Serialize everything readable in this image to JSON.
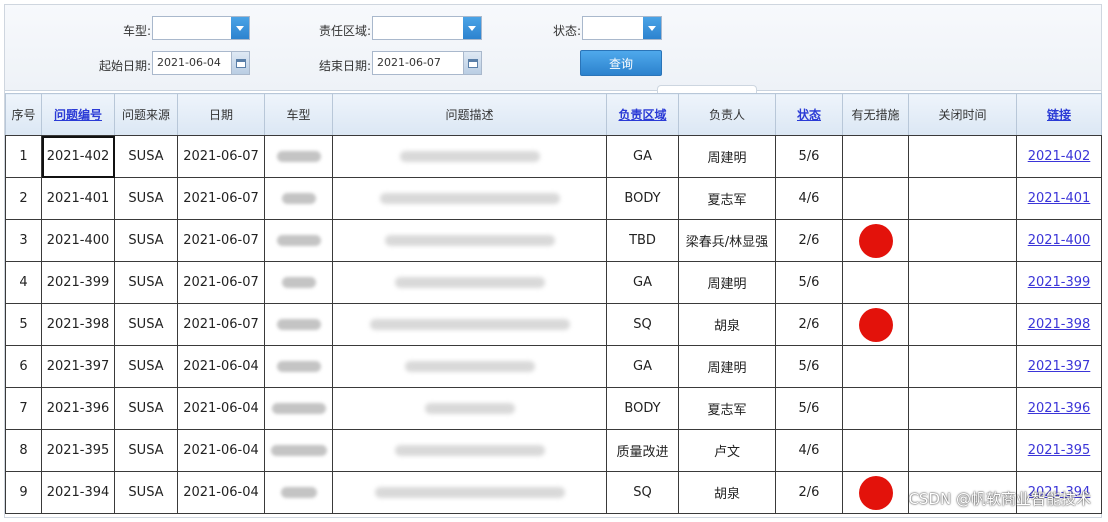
{
  "filters": {
    "car_type_label": "车型:",
    "zone_label": "责任区域:",
    "status_label": "状态:",
    "start_date_label": "起始日期:",
    "start_date_value": "2021-06-04",
    "end_date_label": "结束日期:",
    "end_date_value": "2021-06-07",
    "query_button": "查询"
  },
  "table": {
    "headers": [
      "序号",
      "问题编号",
      "问题来源",
      "日期",
      "车型",
      "问题描述",
      "负责区域",
      "负责人",
      "状态",
      "有无措施",
      "关闭时间",
      "链接"
    ],
    "rows": [
      {
        "no": "1",
        "id": "2021-402",
        "source": "SUSA",
        "date": "2021-06-07",
        "zone": "GA",
        "owner": "周建明",
        "status": "5/6",
        "measure": false,
        "link": "2021-402"
      },
      {
        "no": "2",
        "id": "2021-401",
        "source": "SUSA",
        "date": "2021-06-07",
        "zone": "BODY",
        "owner": "夏志军",
        "status": "4/6",
        "measure": false,
        "link": "2021-401"
      },
      {
        "no": "3",
        "id": "2021-400",
        "source": "SUSA",
        "date": "2021-06-07",
        "zone": "TBD",
        "owner": "梁春兵/林显强",
        "status": "2/6",
        "measure": true,
        "link": "2021-400"
      },
      {
        "no": "4",
        "id": "2021-399",
        "source": "SUSA",
        "date": "2021-06-07",
        "zone": "GA",
        "owner": "周建明",
        "status": "5/6",
        "measure": false,
        "link": "2021-399"
      },
      {
        "no": "5",
        "id": "2021-398",
        "source": "SUSA",
        "date": "2021-06-07",
        "zone": "SQ",
        "owner": "胡泉",
        "status": "2/6",
        "measure": true,
        "link": "2021-398"
      },
      {
        "no": "6",
        "id": "2021-397",
        "source": "SUSA",
        "date": "2021-06-04",
        "zone": "GA",
        "owner": "周建明",
        "status": "5/6",
        "measure": false,
        "link": "2021-397"
      },
      {
        "no": "7",
        "id": "2021-396",
        "source": "SUSA",
        "date": "2021-06-04",
        "zone": "BODY",
        "owner": "夏志军",
        "status": "5/6",
        "measure": false,
        "link": "2021-396"
      },
      {
        "no": "8",
        "id": "2021-395",
        "source": "SUSA",
        "date": "2021-06-04",
        "zone": "质量改进",
        "owner": "卢文",
        "status": "4/6",
        "measure": false,
        "link": "2021-395"
      },
      {
        "no": "9",
        "id": "2021-394",
        "source": "SUSA",
        "date": "2021-06-04",
        "zone": "SQ",
        "owner": "胡泉",
        "status": "2/6",
        "measure": true,
        "link": "2021-394"
      }
    ]
  },
  "colors": {
    "measure_dot": "#e3120b",
    "link": "#3b35d8",
    "button": "#2c82cd"
  },
  "watermark": "CSDN @帆软商业智能技术"
}
